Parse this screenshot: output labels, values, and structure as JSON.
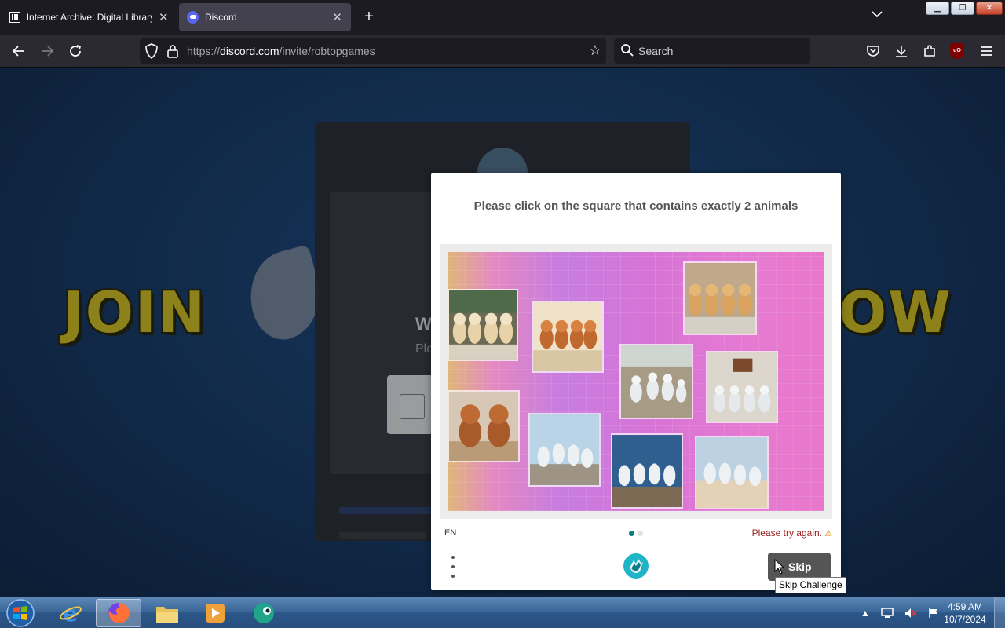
{
  "browser": {
    "tabs": [
      {
        "title": "Internet Archive: Digital Library of Free & Borrowable Books, Movies, Music & Wayback Machine",
        "icon": "internet-archive-icon",
        "active": false
      },
      {
        "title": "Discord",
        "icon": "discord-icon",
        "active": true
      }
    ],
    "url_prefix": "https://",
    "url_domain": "discord.com",
    "url_path": "/invite/robtopgames",
    "search_placeholder": "Search"
  },
  "page": {
    "banner_left": "JOIN",
    "banner_right": "OW",
    "card_heading": "W",
    "card_subtitle": "Ple"
  },
  "captcha": {
    "prompt": "Please click on the square that contains exactly 2 animals",
    "language": "EN",
    "error": "Please try again.",
    "skip_label": "Skip",
    "skip_tooltip": "Skip Challenge",
    "progress_step": 1,
    "progress_total": 2,
    "accent_color": "#0a7c86"
  },
  "taskbar": {
    "apps": [
      "start-orb",
      "internet-explorer",
      "firefox",
      "file-explorer",
      "media-player",
      "bird-app"
    ],
    "active_app": "firefox",
    "time": "4:59 AM",
    "date": "10/7/2024"
  }
}
